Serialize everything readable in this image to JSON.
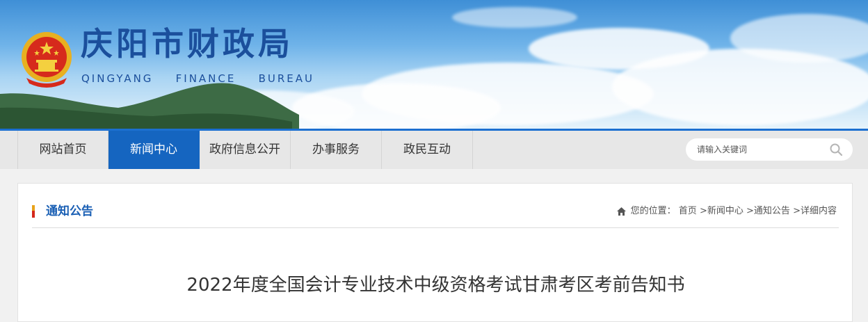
{
  "header": {
    "title": "庆阳市财政局",
    "subtitle_words": [
      "QINGYANG",
      "FINANCE",
      "BUREAU"
    ]
  },
  "nav": {
    "items": [
      {
        "label": "网站首页",
        "active": false
      },
      {
        "label": "新闻中心",
        "active": true
      },
      {
        "label": "政府信息公开",
        "active": false
      },
      {
        "label": "办事服务",
        "active": false
      },
      {
        "label": "政民互动",
        "active": false
      }
    ]
  },
  "search": {
    "placeholder": "请输入关键词",
    "icon": "search-icon"
  },
  "section": {
    "title": "通知公告"
  },
  "breadcrumb": {
    "prefix": "您的位置：",
    "items": [
      "首页",
      "新闻中心",
      "通知公告",
      "详细内容"
    ],
    "separator": ">"
  },
  "article": {
    "title": "2022年度全国会计专业技术中级资格考试甘肃考区考前告知书"
  },
  "colors": {
    "brand_blue": "#1565c0",
    "title_blue": "#1b4f9c",
    "accent_red": "#d4281c",
    "accent_gold": "#e8a21a"
  }
}
